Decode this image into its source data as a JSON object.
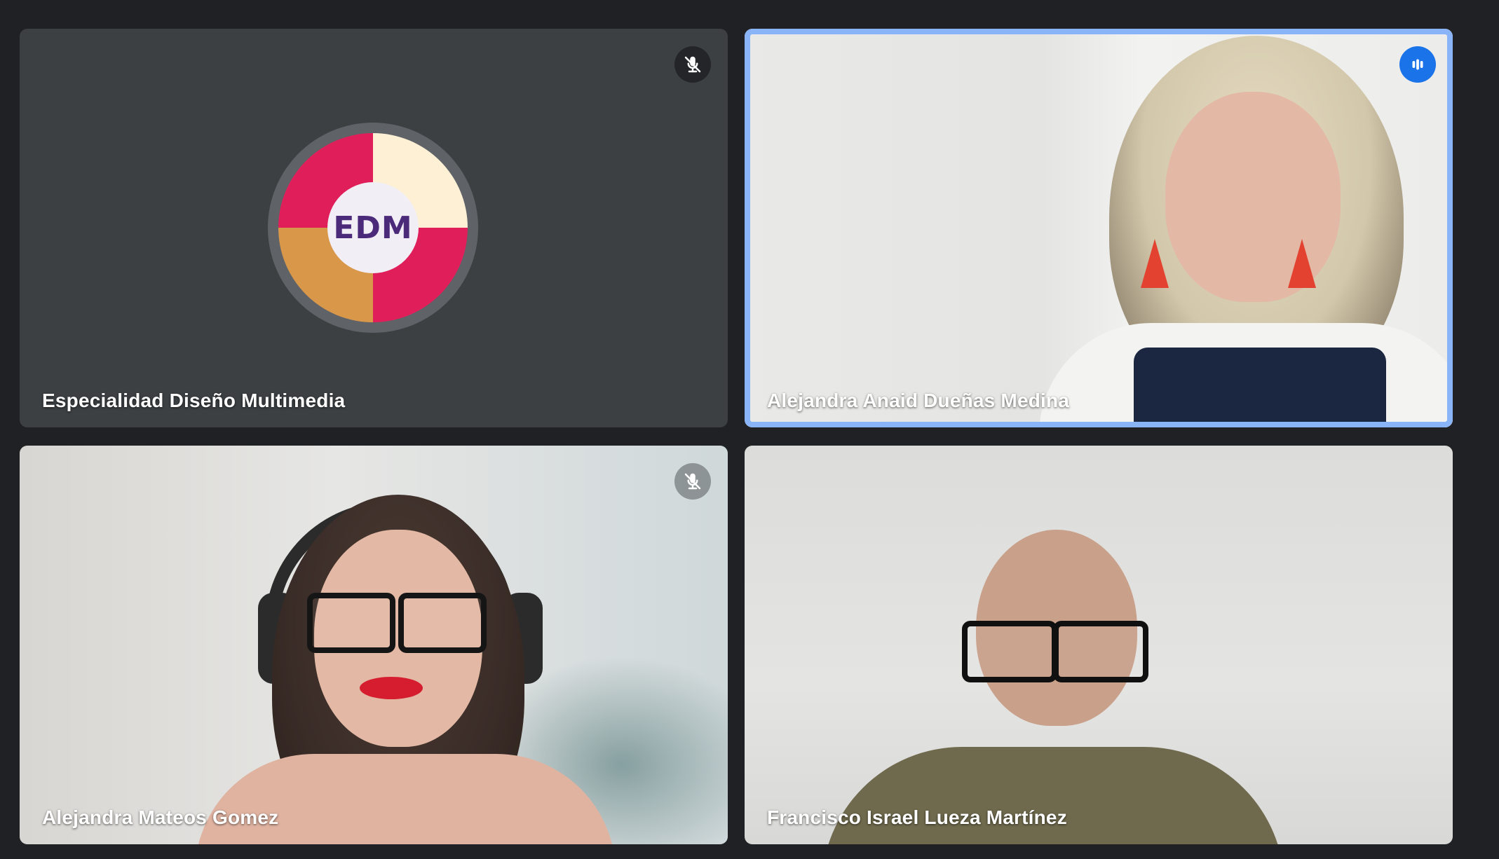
{
  "meeting": {
    "tiles": [
      {
        "name": "Especialidad Diseño Multimedia",
        "avatar_text": "EDM",
        "status_icon": "mic-off-icon",
        "speaking": false
      },
      {
        "name": "Alejandra Anaid Dueñas Medina",
        "status_icon": "audio-level-icon",
        "speaking": true
      },
      {
        "name": "Alejandra Mateos Gomez",
        "status_icon": "mic-off-icon",
        "speaking": false
      },
      {
        "name": "Francisco Israel Lueza Martínez",
        "status_icon": "",
        "speaking": false
      }
    ]
  },
  "colors": {
    "background": "#202124",
    "tile": "#3c4043",
    "speaking_border": "#8ab4f8",
    "speaking_badge": "#1a73e8",
    "avatar_red": "#e01e5a",
    "avatar_cream": "#fdf0d5",
    "avatar_orange": "#d9974a",
    "avatar_text": "#4b2a7a"
  }
}
